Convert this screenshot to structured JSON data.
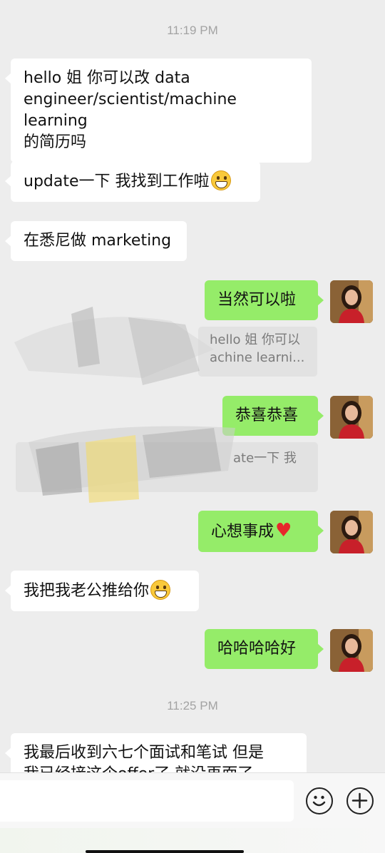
{
  "timestamps": [
    "11:19 PM",
    "11:25 PM"
  ],
  "messages": {
    "m1": "hello 姐 你可以改 data\nengineer/scientist/machine learning\n的简历吗",
    "m2": "update一下 我找到工作啦",
    "m3": "在悉尼做 marketing",
    "m4": "当然可以啦",
    "m4_quote": "hello 姐 你可以\nachine learni...",
    "m5": "恭喜恭喜",
    "m5_quote": "ate一下 我",
    "m6": "心想事成",
    "m7": "我把我老公推给你",
    "m8": "哈哈哈哈好",
    "m9": "我最后收到六七个面试和笔试 但是\n我已经接这个offer了 就没再面了"
  },
  "emojis": {
    "grin": "grinning-face-emoji",
    "heart": "red-heart-emoji"
  },
  "colors": {
    "background": "#ededed",
    "incoming": "#ffffff",
    "outgoing": "#95ec69",
    "timestamp": "#a3a3a3"
  },
  "input": {
    "icons": [
      "emoji-icon",
      "plus-icon"
    ]
  }
}
